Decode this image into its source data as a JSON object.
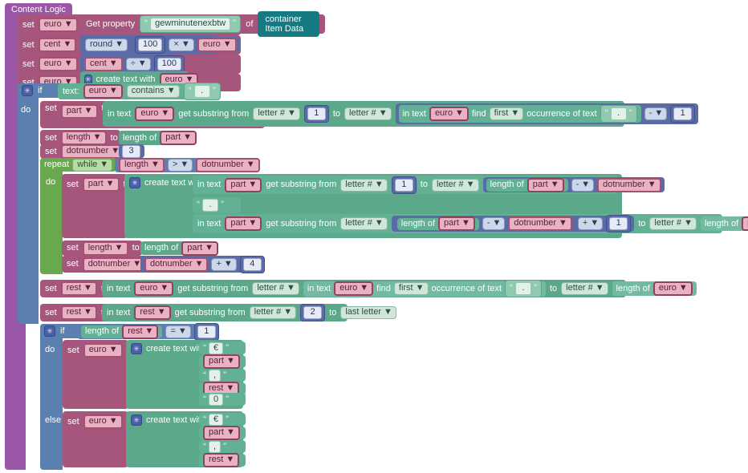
{
  "workspace": {
    "title": "Content Logic",
    "background": "#ffffff"
  },
  "palette": {
    "variable": "#a6567c",
    "text": "#5ba88b",
    "math": "#5b6ba8",
    "control": "#5b7fae",
    "loop": "#6aa84f",
    "component": "#157a82",
    "outer": "#9a57a8"
  },
  "labels": {
    "set": "set",
    "to": "to",
    "if": "if",
    "do": "do",
    "else": "else",
    "repeat": "repeat",
    "while": "while",
    "get_property": "Get property",
    "of": "of",
    "create_text_with": "create text with",
    "length_of": "length of",
    "in_text": "in text",
    "get_substring_from": "get substring from",
    "to_word": "to",
    "find": "find",
    "occurrence_of_text": "occurrence of text",
    "text_label": "text:",
    "contains": "contains",
    "first": "first",
    "letter_num": "letter #",
    "last_letter": "last letter",
    "round": "round",
    "container_item_data": "container Item Data"
  },
  "vars": {
    "euro": "euro",
    "cent": "cent",
    "part": "part",
    "length": "length",
    "dotnumber": "dotnumber",
    "rest": "rest"
  },
  "ops": {
    "multiply": "×",
    "divide": "÷",
    "minus": "-",
    "plus": "+",
    "greater": ">",
    "equals": "="
  },
  "strings": {
    "property_name": "gewminutenexbtw",
    "dot": ".",
    "comma": ",",
    "euro_sign": "€",
    "zero": "0"
  },
  "numbers": {
    "hundred": "100",
    "one": "1",
    "two": "2",
    "three": "3",
    "four": "4"
  },
  "program": [
    {
      "stmt": "set euro to Get property \"gewminutenexbtw\" of container Item Data"
    },
    {
      "stmt": "set cent to round(100 × euro)"
    },
    {
      "stmt": "set euro to (cent ÷ 100)"
    },
    {
      "stmt": "set euro to create text with euro"
    },
    {
      "stmt": "if text: euro contains \".\""
    },
    {
      "stmt": "do set part to in text euro get substring from letter # 1 to letter # (in text euro find first occurrence of text \".\" - 1)"
    },
    {
      "stmt": "set length to length of part"
    },
    {
      "stmt": "set dotnumber to 3"
    },
    {
      "stmt": "repeat while (length > dotnumber)"
    },
    {
      "stmt": "do set part to create text with: in text part get substring from letter # 1 to letter # (length of part - dotnumber); \".\"; in text part get substring from letter # ((length of part - dotnumber) + 1) to letter # (length of part)"
    },
    {
      "stmt": "set length to length of part"
    },
    {
      "stmt": "set dotnumber to (dotnumber + 4)"
    },
    {
      "stmt": "set rest to in text euro get substring from letter # (in text euro find first occurrence of text \".\") to letter # (length of euro)"
    },
    {
      "stmt": "set rest to in text rest get substring from letter # 2 to last letter"
    },
    {
      "stmt": "if (length of rest = 1)"
    },
    {
      "stmt": "do set euro to create text with \"€\", part, \",\", rest, \"0\""
    },
    {
      "stmt": "else set euro to create text with \"€\", part, \",\", rest"
    }
  ]
}
